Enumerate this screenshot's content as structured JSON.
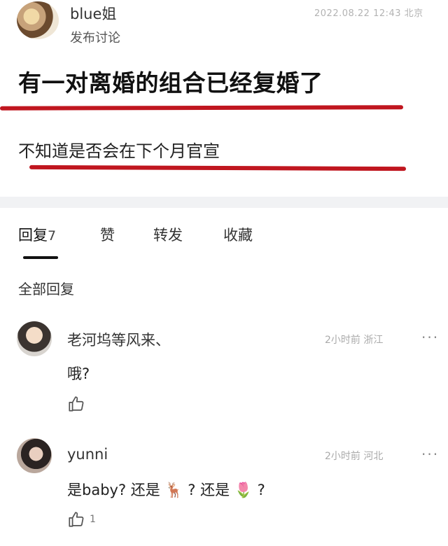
{
  "post": {
    "username": "blue姐",
    "subline": "发布讨论",
    "timestamp": "2022.08.22 12:43 北京",
    "title": "有一对离婚的组合已经复婚了",
    "body": "不知道是否会在下个月官宣"
  },
  "tabs": [
    {
      "label": "回复",
      "count": "7"
    },
    {
      "label": "赞"
    },
    {
      "label": "转发"
    },
    {
      "label": "收藏"
    }
  ],
  "section_label": "全部回复",
  "comments": [
    {
      "name": "老河坞等风来、",
      "meta": "2小时前 浙江",
      "more": "···",
      "text": "哦?",
      "like_count": ""
    },
    {
      "name": "yunni",
      "meta": "2小时前 河北",
      "more": "···",
      "text": "是baby? 还是 🦌 ? 还是 🌷 ?",
      "like_count": "1"
    }
  ],
  "icons": {
    "like": "thumbs-up-icon",
    "more": "more-dots-icon"
  },
  "colors": {
    "underline": "#c0161f",
    "meta": "#aaaaaa"
  }
}
